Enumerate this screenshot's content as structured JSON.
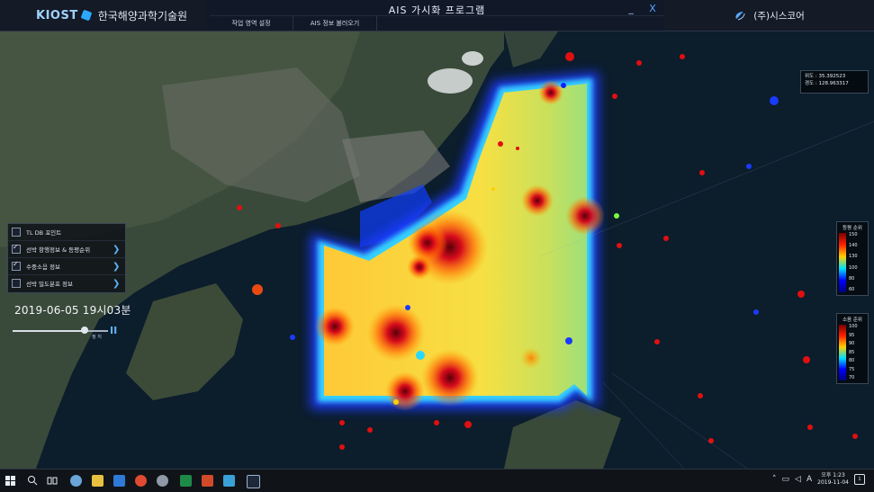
{
  "titlebar": {
    "logo_text": "KIOST",
    "org_name": "한국해양과학기술원",
    "app_title": "AIS 가시화 프로그램",
    "minimize_label": "_",
    "close_label": "X",
    "menu": [
      "작업 영역 설정",
      "AIS 정보 불러오기"
    ],
    "company": "(주)시스코어"
  },
  "coords": {
    "lat_label": "위도 : 35.392523",
    "lon_label": "경도 : 128.963317"
  },
  "panel": {
    "items": [
      {
        "label": "TL DB 포인트",
        "checked": false,
        "chevron": ""
      },
      {
        "label": "선박 항행정보 & 등평순위",
        "checked": true,
        "chevron": "❯"
      },
      {
        "label": "수중소음 정보",
        "checked": true,
        "chevron": "❯"
      },
      {
        "label": "선박 밀도분포 정보",
        "checked": false,
        "chevron": "❯"
      }
    ]
  },
  "datetime": "2019-06-05 19시03분",
  "playback": {
    "progress": 0.75,
    "speed_label": "정 지",
    "pause_label": "II"
  },
  "legend_ship": {
    "title": "등평 순위",
    "ticks": [
      "150",
      "140",
      "130",
      "100",
      "80",
      "60"
    ],
    "colors": [
      "#7a0000",
      "#ff2200",
      "#ffd000",
      "#00e0ff",
      "#0000ff",
      "#000080"
    ]
  },
  "legend_noise": {
    "title": "소음 준위",
    "ticks": [
      "100",
      "95",
      "90",
      "85",
      "80",
      "75",
      "70"
    ],
    "colors": [
      "#7a0000",
      "#ff2200",
      "#ffd000",
      "#00e0ff",
      "#0000ff",
      "#000080"
    ]
  },
  "taskbar": {
    "tray_lang": "A",
    "time": "오후 1:23",
    "date": "2019-11-04",
    "notify": "1"
  }
}
